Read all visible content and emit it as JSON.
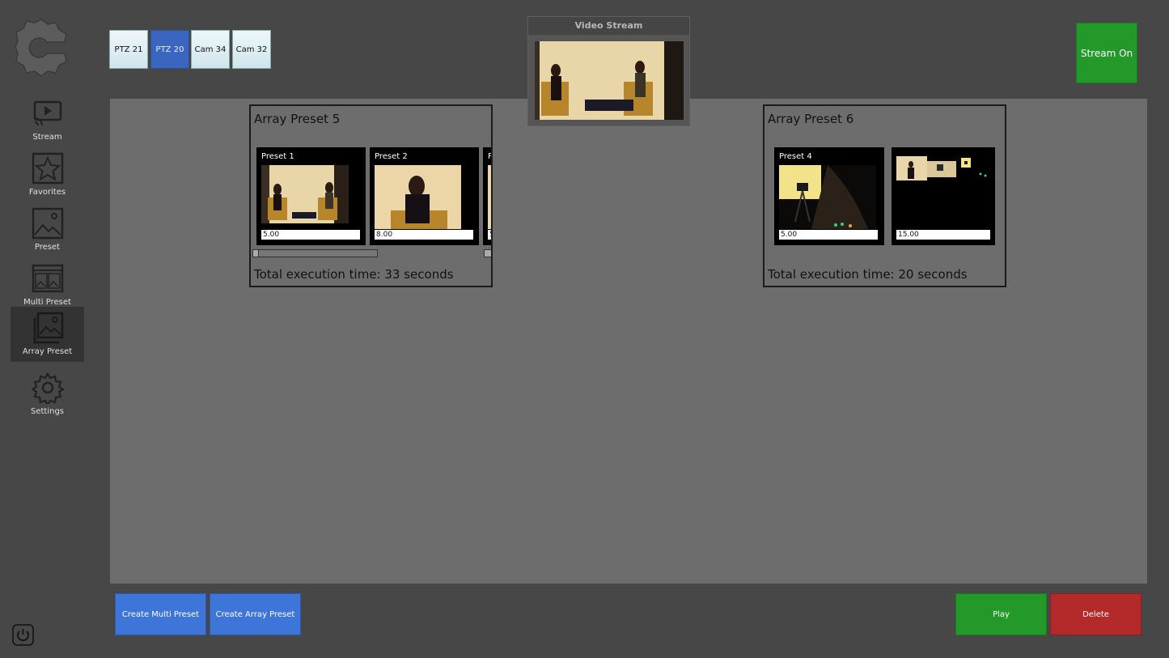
{
  "sidebar": {
    "items": [
      {
        "label": "Stream",
        "icon": "stream-icon"
      },
      {
        "label": "Favorites",
        "icon": "star-icon"
      },
      {
        "label": "Preset",
        "icon": "image-icon"
      },
      {
        "label": "Multi Preset",
        "icon": "multi-image-icon"
      },
      {
        "label": "Array Preset",
        "icon": "array-image-icon"
      },
      {
        "label": "Settings",
        "icon": "gear-icon"
      }
    ],
    "active": "Array Preset"
  },
  "cameras": [
    {
      "label": "PTZ 21",
      "active": false
    },
    {
      "label": "PTZ 20",
      "active": true
    },
    {
      "label": "Cam 34",
      "active": false
    },
    {
      "label": "Cam 32",
      "active": false
    }
  ],
  "video": {
    "title": "Video Stream"
  },
  "stream_button": {
    "label": "Stream On"
  },
  "arrays": [
    {
      "title": "Array Preset 5",
      "total": "Total execution time: 33 seconds",
      "presets": [
        {
          "title": "Preset 1",
          "value": "5.00"
        },
        {
          "title": "Preset 2",
          "value": "8.00"
        },
        {
          "title": "P",
          "value": "5"
        }
      ]
    },
    {
      "title": "Array Preset 6",
      "total": "Total execution time: 20 seconds",
      "presets": [
        {
          "title": "Preset 4",
          "value": "5.00"
        },
        {
          "title": "",
          "value": "15.00"
        }
      ]
    }
  ],
  "buttons": {
    "create_multi": "Create Multi Preset",
    "create_array": "Create Array Preset",
    "play": "Play",
    "delete": "Delete"
  },
  "colors": {
    "accent_blue": "#3d75d8",
    "green": "#23992a",
    "red": "#b42a2a"
  }
}
